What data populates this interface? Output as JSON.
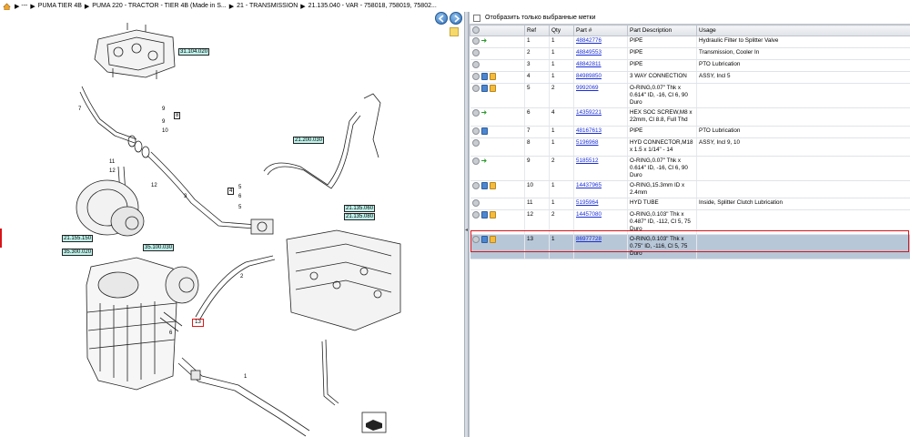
{
  "breadcrumb": {
    "items": [
      "---",
      "PUMA TIER 4B",
      "PUMA 220 - TRACTOR - TIER 4B (Made in S...",
      "21 - TRANSMISSION",
      "21.135.040 - VAR - 758018, 758019, 75802..."
    ]
  },
  "diagram": {
    "tags": [
      "31.104.020",
      "21.200.030",
      "21.135.060",
      "21.135.080",
      "21.155.150",
      "35.100.030",
      "35.300.020"
    ],
    "callouts": [
      "7",
      "9",
      "8",
      "9",
      "10",
      "11",
      "12",
      "12",
      "3",
      "4",
      "5",
      "6",
      "5",
      "2",
      "6",
      "1"
    ],
    "highlighted_ref": "13"
  },
  "filter": {
    "label": "Отобразить только выбранные метки"
  },
  "table": {
    "headers": {
      "ref": "Ref",
      "qty": "Qty",
      "part": "Part #",
      "desc": "Part Description",
      "usage": "Usage"
    },
    "rows": [
      {
        "icons": [
          "circle",
          "arrow"
        ],
        "ref": "1",
        "qty": "1",
        "part": "48842776",
        "desc": "PIPE",
        "usage": "Hydraulic Filter to Splitter Valve"
      },
      {
        "icons": [
          "circle"
        ],
        "ref": "2",
        "qty": "1",
        "part": "48849553",
        "desc": "PIPE",
        "usage": "Transmission, Cooler In"
      },
      {
        "icons": [
          "circle"
        ],
        "ref": "3",
        "qty": "1",
        "part": "48842811",
        "desc": "PIPE",
        "usage": "PTO Lubrication"
      },
      {
        "icons": [
          "circle",
          "book",
          "box"
        ],
        "ref": "4",
        "qty": "1",
        "part": "84989850",
        "desc": "3 WAY CONNECTION",
        "usage": "ASSY, Incl 5"
      },
      {
        "icons": [
          "circle",
          "book",
          "box"
        ],
        "ref": "5",
        "qty": "2",
        "part": "9992069",
        "desc": "O-RING,0.07\" Thk x 0.614\" ID, -16, Cl 6, 90 Duro",
        "usage": ""
      },
      {
        "icons": [
          "circle",
          "arrow"
        ],
        "ref": "6",
        "qty": "4",
        "part": "14359221",
        "desc": "HEX SOC SCREW,M8 x 22mm, Cl 8.8, Full Thd",
        "usage": ""
      },
      {
        "icons": [
          "circle",
          "book"
        ],
        "ref": "7",
        "qty": "1",
        "part": "48167613",
        "desc": "PIPE",
        "usage": "PTO Lubrication"
      },
      {
        "icons": [
          "circle"
        ],
        "ref": "8",
        "qty": "1",
        "part": "5196968",
        "desc": "HYD CONNECTOR,M18 x 1.5 x 1/14\" - 14",
        "usage": "ASSY, Incl 9, 10"
      },
      {
        "icons": [
          "circle",
          "arrow"
        ],
        "ref": "9",
        "qty": "2",
        "part": "5185512",
        "desc": "O-RING,0.07\" Thk x 0.614\" ID, -16, Cl 6, 90 Duro",
        "usage": ""
      },
      {
        "icons": [
          "circle",
          "book",
          "box"
        ],
        "ref": "10",
        "qty": "1",
        "part": "14437965",
        "desc": "O-RING,15.3mm ID x 2.4mm",
        "usage": ""
      },
      {
        "icons": [
          "circle"
        ],
        "ref": "11",
        "qty": "1",
        "part": "5195964",
        "desc": "HYD TUBE",
        "usage": "Inside, Splitter Clutch Lubrication"
      },
      {
        "icons": [
          "circle",
          "book",
          "box"
        ],
        "ref": "12",
        "qty": "2",
        "part": "14457080",
        "desc": "O-RING,0.103\" Thk x 0.487\" ID, -112, Cl 5, 75 Duro",
        "usage": ""
      },
      {
        "icons": [
          "circle",
          "book",
          "box"
        ],
        "ref": "13",
        "qty": "1",
        "part": "86977728",
        "desc": "O-RING,0.103\" Thk x 0.75\" ID, -116, Cl 5, 75 Duro",
        "usage": ""
      }
    ]
  }
}
